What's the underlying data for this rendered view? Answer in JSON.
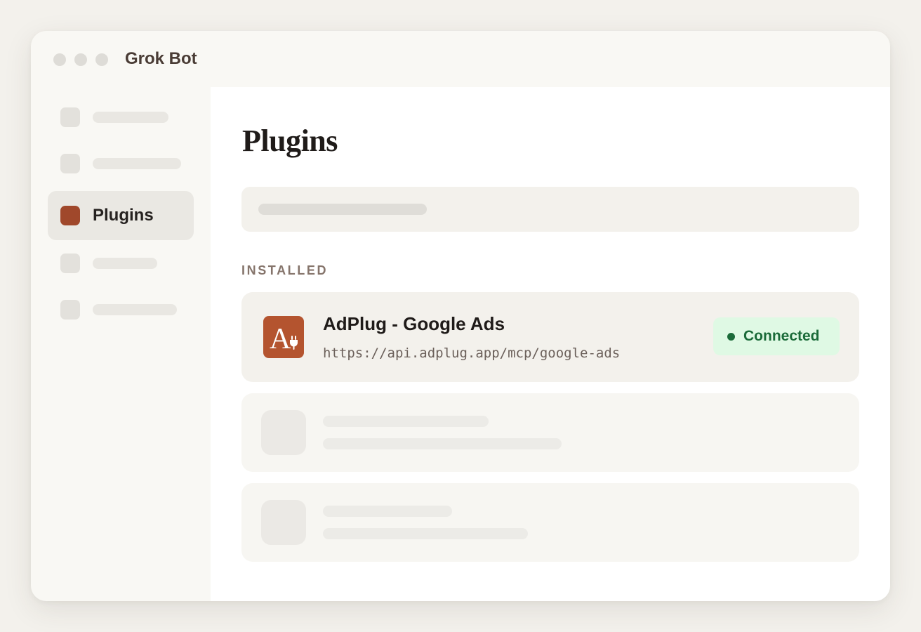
{
  "window": {
    "title": "Grok Bot"
  },
  "sidebar": {
    "items": [
      {
        "label": "",
        "placeholder": true
      },
      {
        "label": "",
        "placeholder": true
      },
      {
        "label": "Plugins",
        "active": true,
        "icon": "plugins-icon"
      },
      {
        "label": "",
        "placeholder": true
      },
      {
        "label": "",
        "placeholder": true
      }
    ]
  },
  "main": {
    "title": "Plugins",
    "section_label": "INSTALLED",
    "installed": [
      {
        "name": "AdPlug - Google Ads",
        "url": "https://api.adplug.app/mcp/google-ads",
        "status": "Connected",
        "logo_letter": "A",
        "logo_color": "#b4542f"
      }
    ]
  },
  "colors": {
    "accent": "#a0482b",
    "status_connected_bg": "#dff9e4",
    "status_connected_text": "#1b6b39"
  }
}
